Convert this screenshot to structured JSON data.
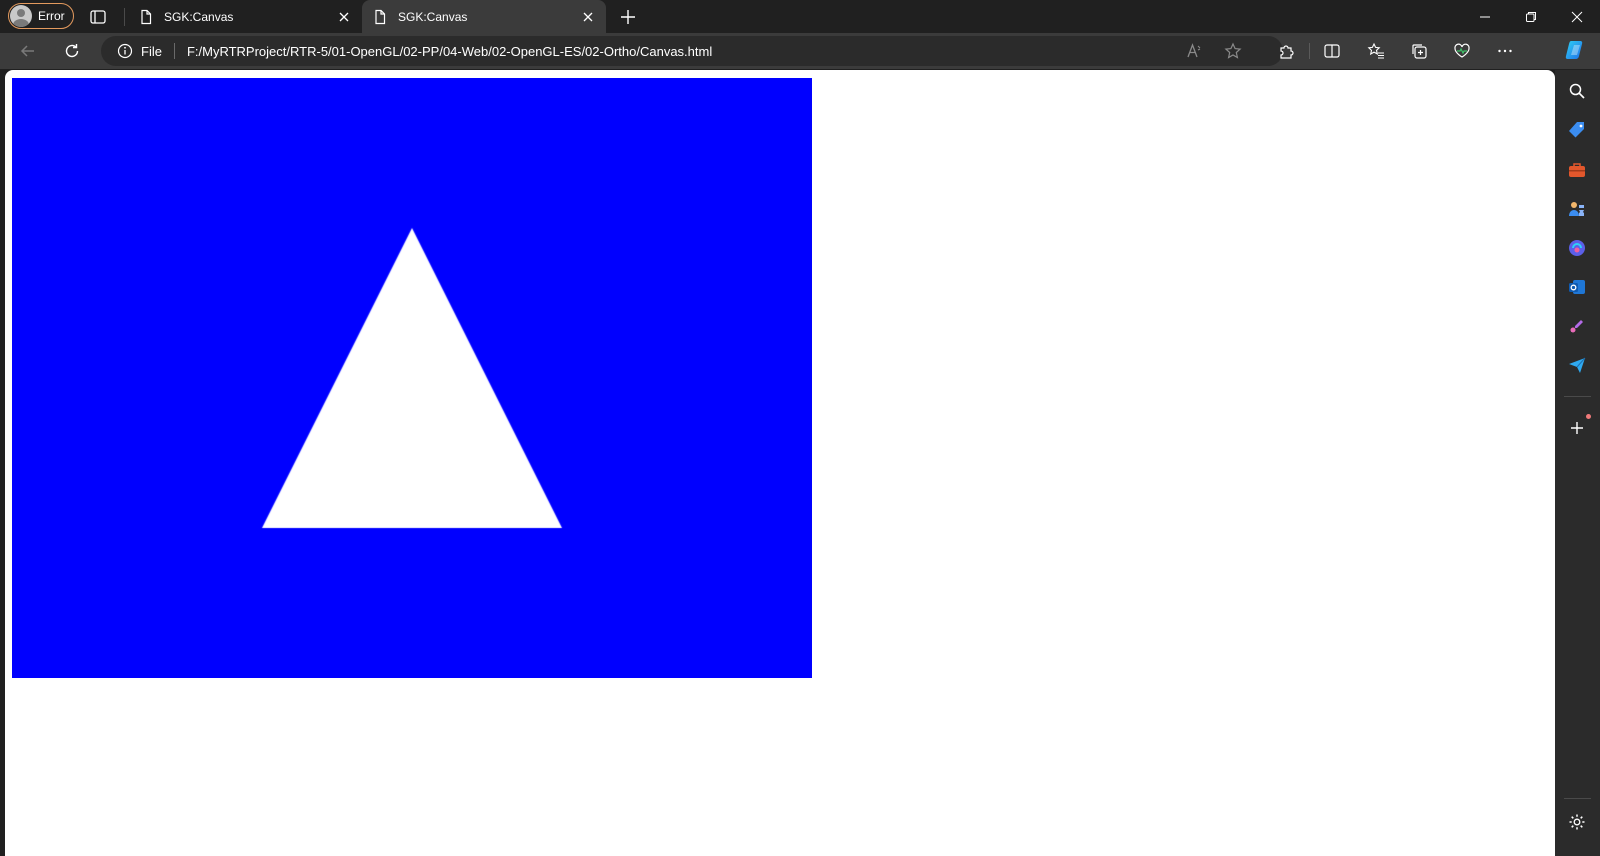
{
  "window": {
    "profile_label": "Error",
    "tabs": [
      {
        "title": "SGK:Canvas",
        "active": false
      },
      {
        "title": "SGK:Canvas",
        "active": true
      }
    ]
  },
  "toolbar": {
    "scheme_label": "File",
    "url": "F:/MyRTRProject/RTR-5/01-OpenGL/02-PP/04-Web/02-OpenGL-ES/02-Ortho/Canvas.html"
  },
  "canvas": {
    "clear_color": "#0000ff",
    "triangle_color": "#ffffff",
    "ortho_triangle": [
      [
        0,
        50
      ],
      [
        -50,
        -50
      ],
      [
        50,
        -50
      ]
    ],
    "ortho_extent": 100,
    "viewport_aspect": 1.3333
  },
  "colors": {
    "accent": "#e39a5e",
    "frame": "#202020",
    "toolbar": "#3b3b3b"
  },
  "sidebar": {
    "icons": [
      "search-icon",
      "shopping-tag-icon",
      "toolbox-icon",
      "chess-icon",
      "copilot-icon",
      "outlook-icon",
      "designer-icon",
      "send-icon",
      "add-icon",
      "settings-icon"
    ]
  }
}
